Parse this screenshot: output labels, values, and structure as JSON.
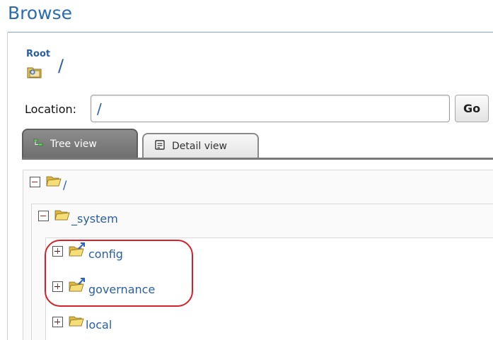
{
  "page": {
    "title": "Browse"
  },
  "breadcrumb": {
    "root_label": "Root",
    "path": "/"
  },
  "location": {
    "label": "Location:",
    "value": "/",
    "go_label": "Go"
  },
  "tabs": [
    {
      "label": "Tree view",
      "active": true,
      "icon": "tree-icon"
    },
    {
      "label": "Detail view",
      "active": false,
      "icon": "detail-icon"
    }
  ],
  "tree": {
    "nodes": [
      {
        "label": "/",
        "expanded": true,
        "type": "folder"
      },
      {
        "label": "_system",
        "expanded": true,
        "type": "folder"
      },
      {
        "label": "config",
        "expanded": false,
        "type": "linked-folder"
      },
      {
        "label": "governance",
        "expanded": false,
        "type": "linked-folder"
      },
      {
        "label": "local",
        "expanded": false,
        "type": "folder"
      }
    ]
  },
  "colors": {
    "link": "#2a5fa3",
    "title": "#2a6cb0",
    "highlight": "#d5202a",
    "tab_active": "#7a7a7a"
  }
}
